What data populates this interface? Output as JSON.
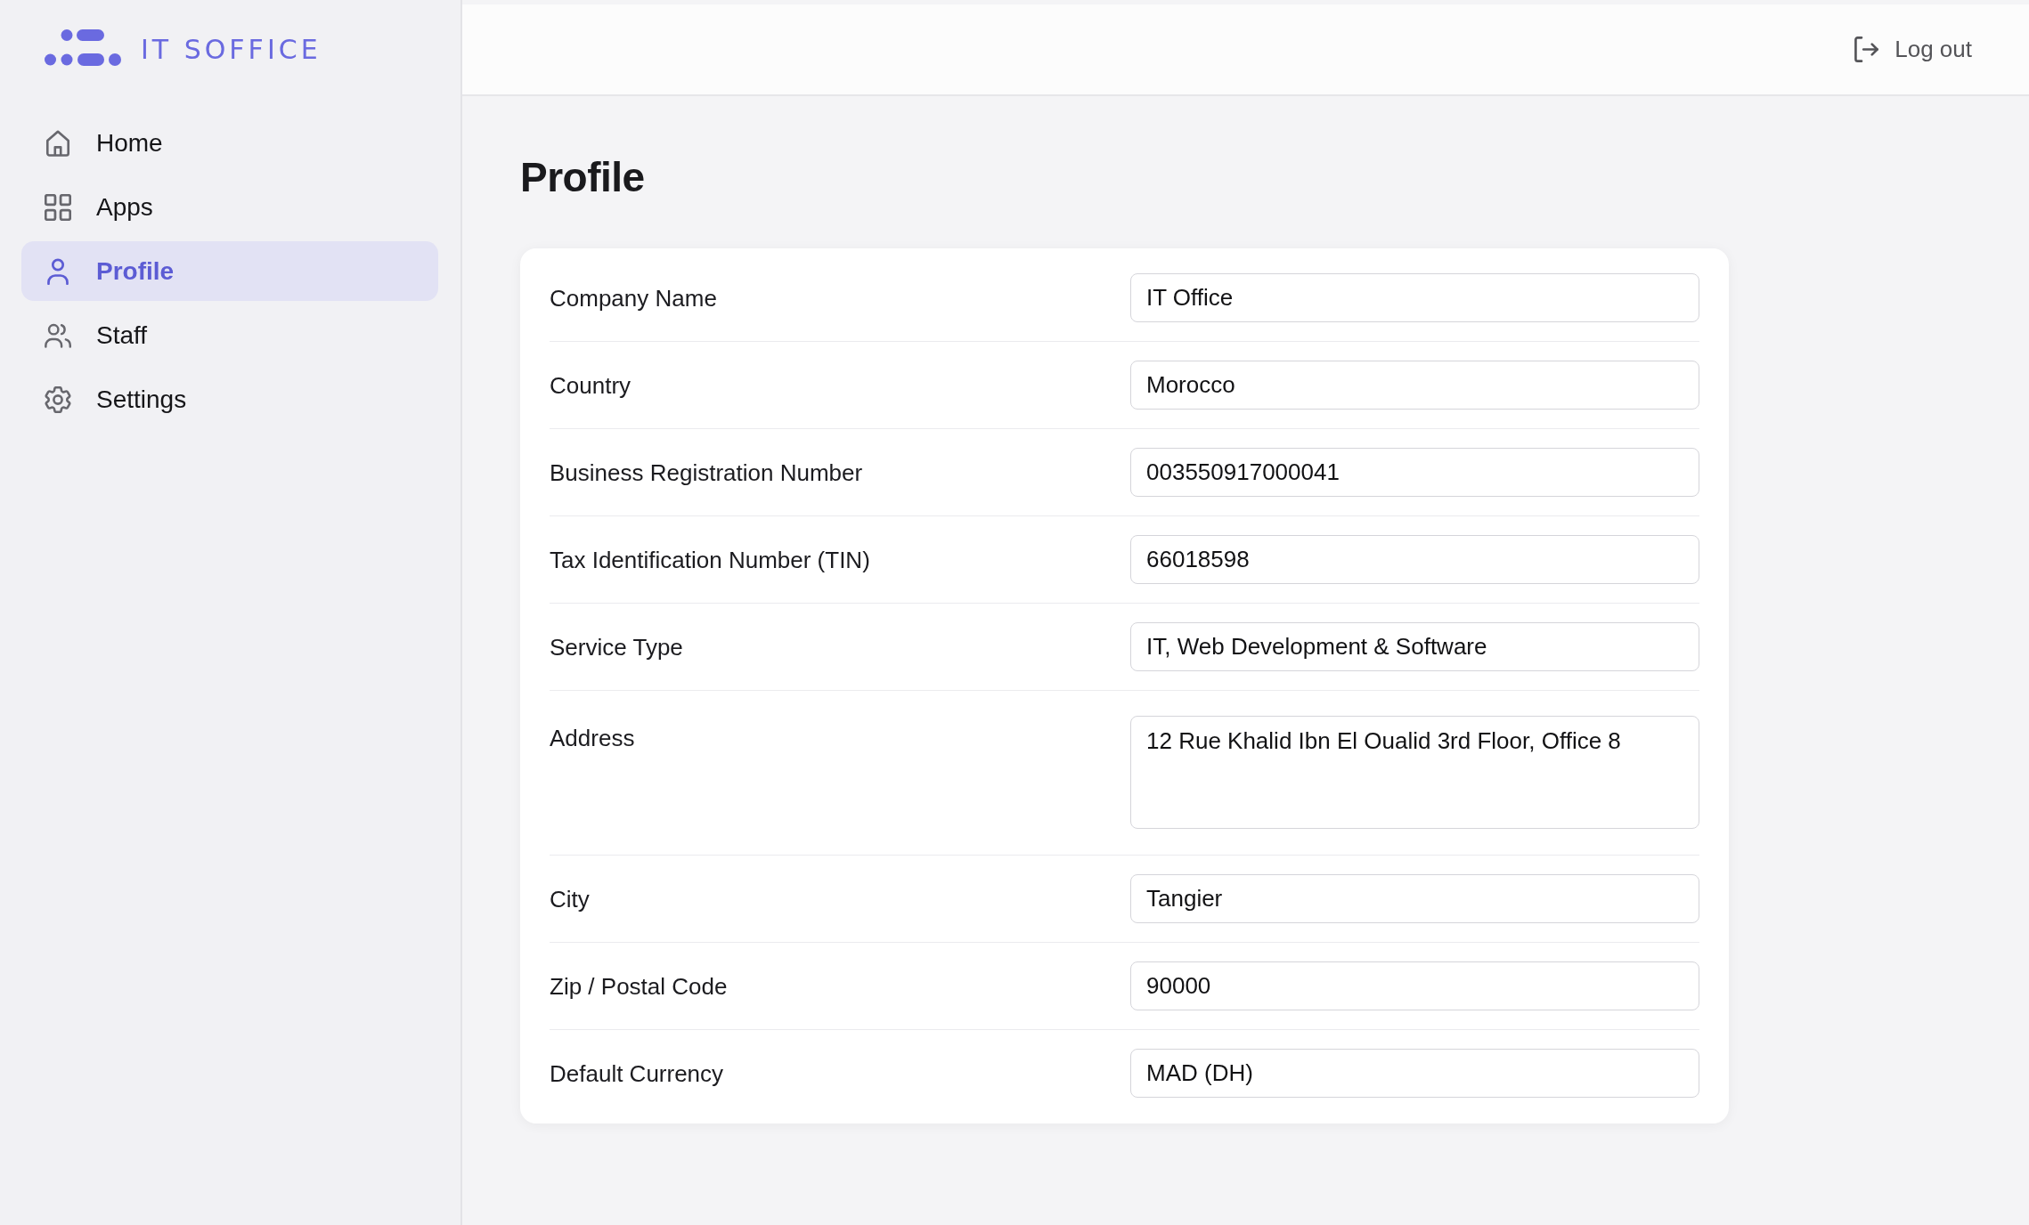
{
  "sidebar": {
    "logo": "IT SOFFICE",
    "items": [
      {
        "label": "Home",
        "selected": false
      },
      {
        "label": "Apps",
        "selected": false
      },
      {
        "label": "Profile",
        "selected": true
      },
      {
        "label": "Staff",
        "selected": false
      },
      {
        "label": "Settings",
        "selected": false
      }
    ]
  },
  "header": {
    "logout": "Log out"
  },
  "page_title": "Profile",
  "profile_form": {
    "fields": [
      {
        "kind": "text",
        "label": "Company Name",
        "value": "IT Office"
      },
      {
        "kind": "text",
        "label": "Country",
        "value": "Morocco"
      },
      {
        "kind": "text",
        "label": "Business Registration Number",
        "value": "003550917000041"
      },
      {
        "kind": "text",
        "label": "Tax Identification Number (TIN)",
        "value": "66018598"
      },
      {
        "kind": "text",
        "label": "Service Type",
        "value": "IT, Web Development & Software"
      },
      {
        "kind": "multiline",
        "label": "Address",
        "value": "12 Rue Khalid Ibn El Oualid 3rd Floor, Office 8"
      },
      {
        "kind": "text",
        "label": "City",
        "value": "Tangier"
      },
      {
        "kind": "text",
        "label": "Zip / Postal Code",
        "value": "90000"
      },
      {
        "kind": "text",
        "label": "Default Currency",
        "value": "MAD (DH)"
      }
    ]
  }
}
